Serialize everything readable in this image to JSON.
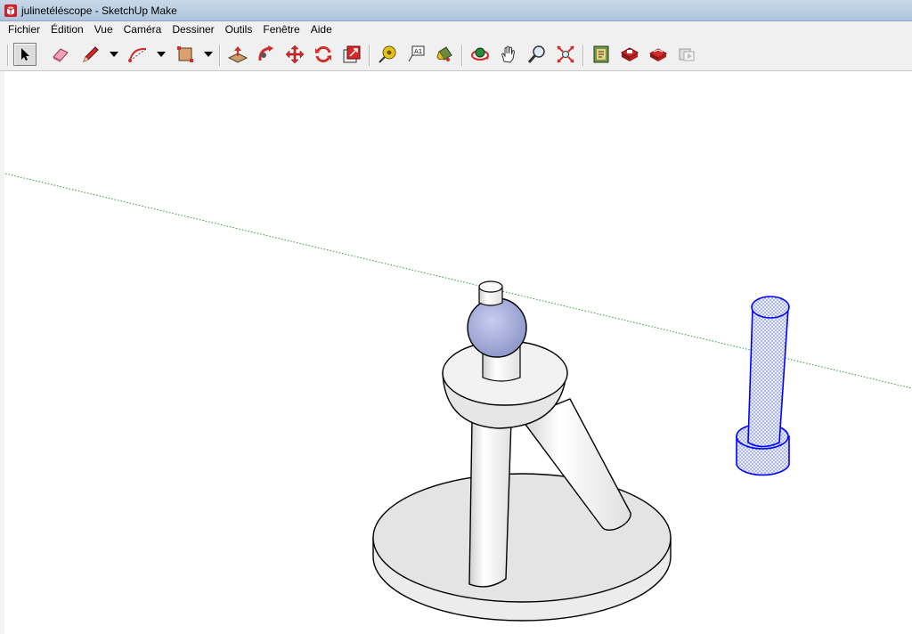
{
  "window": {
    "title": "julinetéléscope - SketchUp Make",
    "logo_icon": "sketchup-logo-icon"
  },
  "menu": {
    "items": [
      "Fichier",
      "Édition",
      "Vue",
      "Caméra",
      "Dessiner",
      "Outils",
      "Fenêtre",
      "Aide"
    ]
  },
  "toolbar": {
    "tools": [
      "select-arrow-icon",
      "eraser-icon",
      "pencil-icon",
      "arc-icon",
      "rectangle-icon",
      "push-pull-icon",
      "follow-me-icon",
      "move-icon",
      "rotate-icon",
      "scale-icon",
      "tape-measure-icon",
      "text-icon",
      "paint-bucket-icon",
      "orbit-icon",
      "pan-icon",
      "zoom-icon",
      "zoom-extents-icon",
      "warehouse-icon",
      "get-models-icon",
      "share-model-icon",
      "extension-icon"
    ],
    "active_tool": "select-arrow-icon"
  },
  "colors": {
    "selection_blue": "#0000ff",
    "axis_green": "#2e9a2e",
    "sphere_fill": "#a8b0dc",
    "model_gray": "#e6e6e6"
  }
}
